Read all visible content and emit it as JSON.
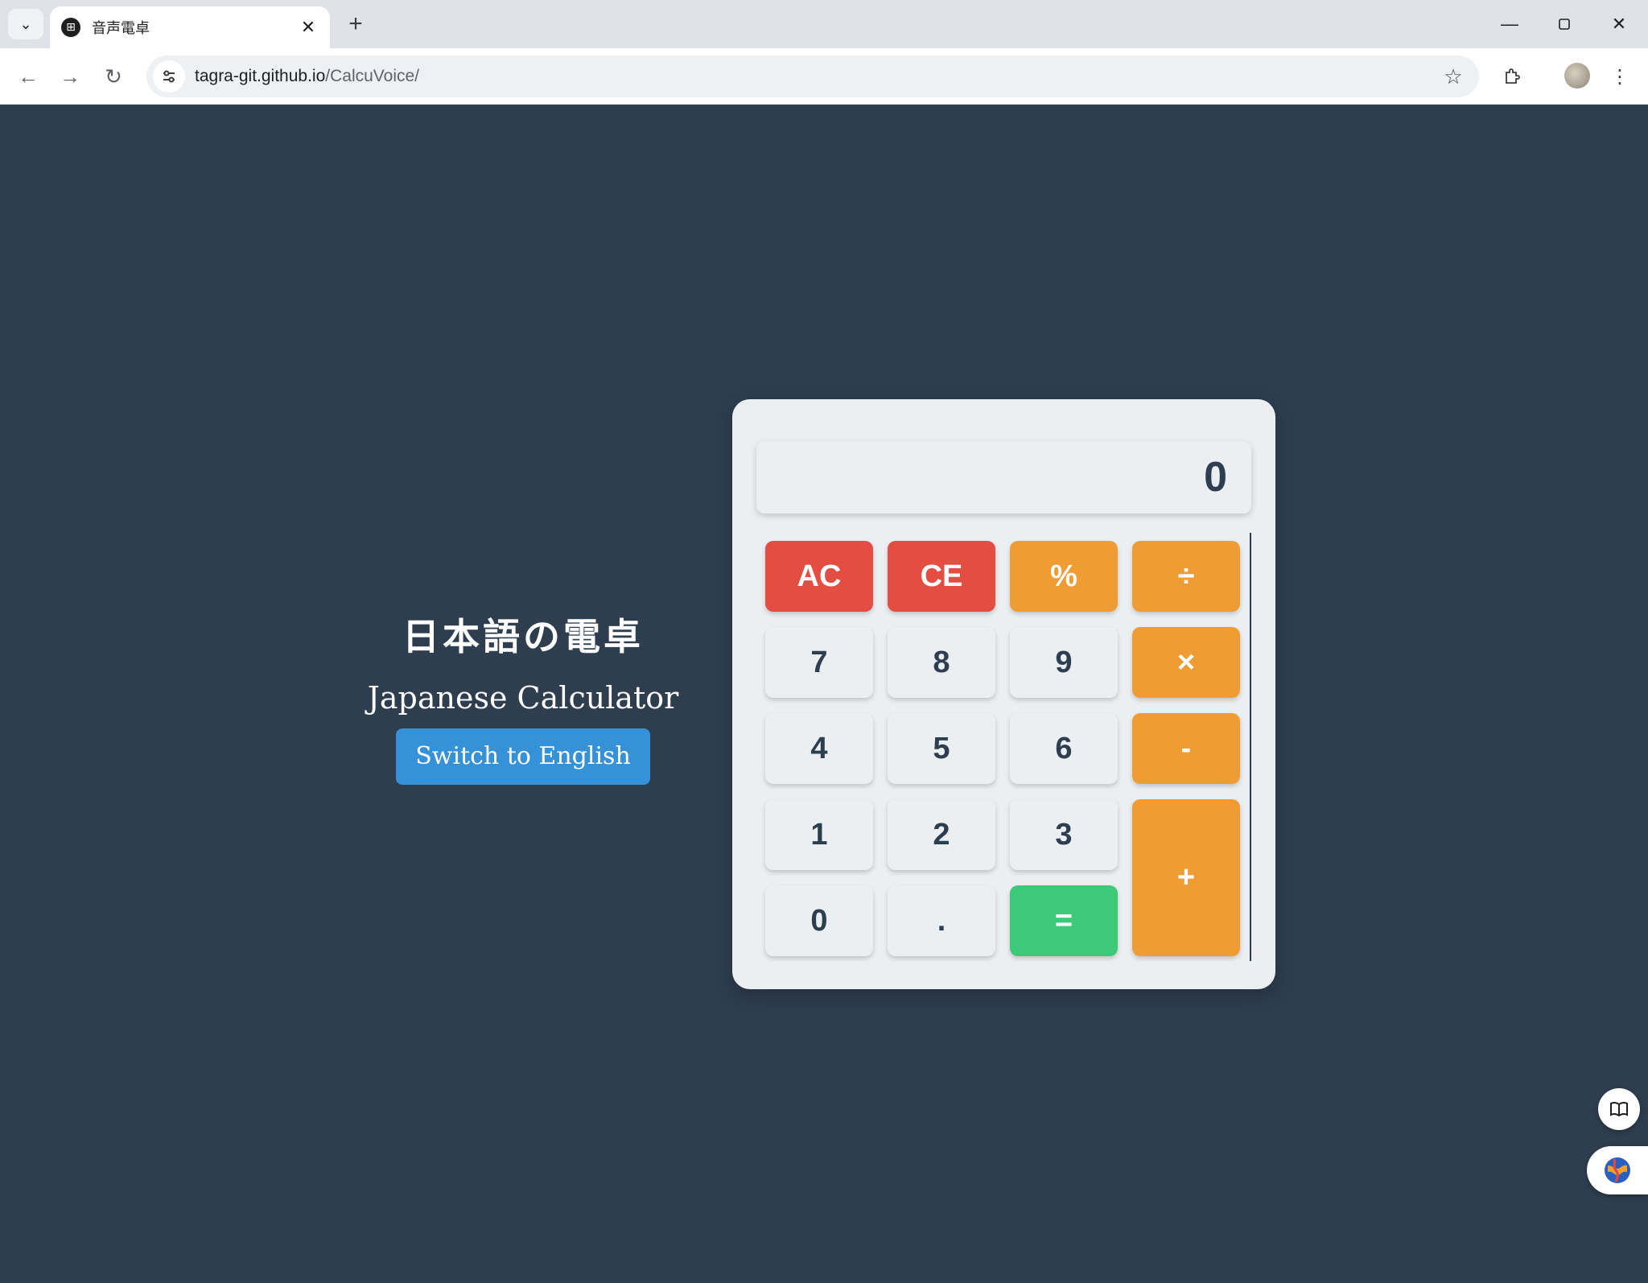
{
  "browser": {
    "tab_title": "音声電卓",
    "url_domain": "tagra-git.github.io",
    "url_path": "/CalcuVoice/"
  },
  "page": {
    "jp_title": "日本語の電卓",
    "en_title": "Japanese Calculator",
    "switch_label": "Switch to English"
  },
  "calculator": {
    "display": "0",
    "keys": {
      "ac": "AC",
      "ce": "CE",
      "percent": "%",
      "divide": "÷",
      "seven": "7",
      "eight": "8",
      "nine": "9",
      "multiply": "×",
      "four": "4",
      "five": "5",
      "six": "6",
      "minus": "-",
      "one": "1",
      "two": "2",
      "three": "3",
      "plus": "+",
      "zero": "0",
      "dot": ".",
      "equals": "="
    }
  },
  "colors": {
    "background": "#2e3e4f",
    "clear_red": "#e34d42",
    "operator_orange": "#f09c35",
    "equals_green": "#3cc97a",
    "switch_blue": "#3592d9"
  }
}
